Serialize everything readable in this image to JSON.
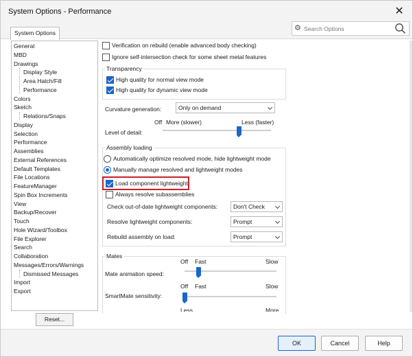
{
  "window": {
    "title": "System Options - Performance",
    "close_glyph": "✕"
  },
  "tab": {
    "label": "System Options"
  },
  "search": {
    "placeholder": "Search Options"
  },
  "nav": {
    "items": [
      {
        "label": "General",
        "sub": false
      },
      {
        "label": "MBD",
        "sub": false
      },
      {
        "label": "Drawings",
        "sub": false
      },
      {
        "label": "Display Style",
        "sub": true
      },
      {
        "label": "Area Hatch/Fill",
        "sub": true
      },
      {
        "label": "Performance",
        "sub": true
      },
      {
        "label": "Colors",
        "sub": false
      },
      {
        "label": "Sketch",
        "sub": false
      },
      {
        "label": "Relations/Snaps",
        "sub": true
      },
      {
        "label": "Display",
        "sub": false
      },
      {
        "label": "Selection",
        "sub": false
      },
      {
        "label": "Performance",
        "sub": false,
        "selected": true
      },
      {
        "label": "Assemblies",
        "sub": false
      },
      {
        "label": "External References",
        "sub": false
      },
      {
        "label": "Default Templates",
        "sub": false
      },
      {
        "label": "File Locations",
        "sub": false
      },
      {
        "label": "FeatureManager",
        "sub": false
      },
      {
        "label": "Spin Box Increments",
        "sub": false
      },
      {
        "label": "View",
        "sub": false
      },
      {
        "label": "Backup/Recover",
        "sub": false
      },
      {
        "label": "Touch",
        "sub": false
      },
      {
        "label": "Hole Wizard/Toolbox",
        "sub": false
      },
      {
        "label": "File Explorer",
        "sub": false
      },
      {
        "label": "Search",
        "sub": false
      },
      {
        "label": "Collaboration",
        "sub": false
      },
      {
        "label": "Messages/Errors/Warnings",
        "sub": false
      },
      {
        "label": "Dismissed Messages",
        "sub": true
      },
      {
        "label": "Import",
        "sub": false
      },
      {
        "label": "Export",
        "sub": false
      }
    ]
  },
  "reset_label": "Reset...",
  "options": {
    "verification": {
      "label": "Verification on rebuild (enable advanced body checking)",
      "checked": false
    },
    "ignore_self": {
      "label": "Ignore self-intersection check for some sheet metal features",
      "checked": false
    }
  },
  "transparency": {
    "title": "Transparency",
    "normal": {
      "label": "High quality for normal view mode",
      "checked": true
    },
    "dynamic": {
      "label": "High quality for dynamic view mode",
      "checked": true
    }
  },
  "curvature": {
    "label": "Curvature generation:",
    "value": "Only on demand"
  },
  "detail": {
    "label": "Level of detail:",
    "off": "Off",
    "more": "More (slower)",
    "less": "Less (faster)",
    "level": 0.7
  },
  "assembly": {
    "title": "Assembly loading",
    "auto": {
      "label": "Automatically optimize resolved mode, hide lightweight mode",
      "selected": false
    },
    "manual": {
      "label": "Manually manage resolved and lightweight modes",
      "selected": true
    },
    "load_lightweight": {
      "label": "Load component lightweight",
      "checked": true
    },
    "always_resolve": {
      "label": "Always resolve subassemblies",
      "checked": false
    },
    "check_ood": {
      "label": "Check out-of-date lightweight components:",
      "value": "Don't Check"
    },
    "resolve_lw": {
      "label": "Resolve lightweight components:",
      "value": "Prompt"
    },
    "rebuild": {
      "label": "Rebuild assembly on load:",
      "value": "Prompt"
    }
  },
  "mates": {
    "title": "Mates",
    "animation": {
      "label": "Mate animation speed:",
      "off": "Off",
      "fast": "Fast",
      "slow": "Slow",
      "level": 0.15
    },
    "smartmate": {
      "label": "SmartMate sensitivity:",
      "off": "Off",
      "fast": "Fast",
      "slow": "Slow",
      "less": "Less",
      "more": "More",
      "level": 0.0
    }
  },
  "footer": {
    "ok": "OK",
    "cancel": "Cancel",
    "help": "Help"
  },
  "colors": {
    "accent": "#1b66c9",
    "highlight": "#c8202a"
  }
}
